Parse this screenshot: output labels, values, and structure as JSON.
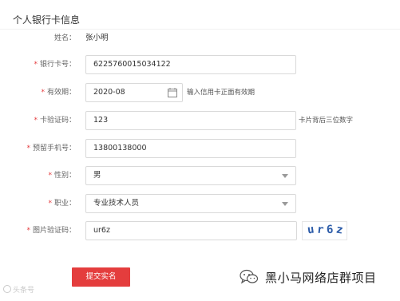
{
  "form": {
    "title": "个人银行卡信息",
    "required_mark": "*",
    "name": {
      "label": "姓名：",
      "value": "张小明"
    },
    "card_number": {
      "label": "银行卡号：",
      "value": "6225760015034122"
    },
    "expiry": {
      "label": "有效期：",
      "value": "2020-08",
      "hint": "输入信用卡正面有效期"
    },
    "cvv": {
      "label": "卡验证码：",
      "value": "123",
      "hint": "卡片背后三位数字"
    },
    "phone": {
      "label": "预留手机号：",
      "value": "13800138000"
    },
    "gender": {
      "label": "性别：",
      "value": "男"
    },
    "occupation": {
      "label": "职业：",
      "value": "专业技术人员"
    },
    "captcha": {
      "label": "图片验证码：",
      "value": "ur6z",
      "image_chars": [
        "u",
        "r",
        "6",
        "z"
      ]
    },
    "submit_label": "提交实名"
  },
  "watermark": {
    "left_text": "头条号",
    "brand_text": "黑小马网络店群项目"
  },
  "colors": {
    "accent": "#e43d3d",
    "required": "#e4393c",
    "captcha_text": "#2b5ba8"
  }
}
